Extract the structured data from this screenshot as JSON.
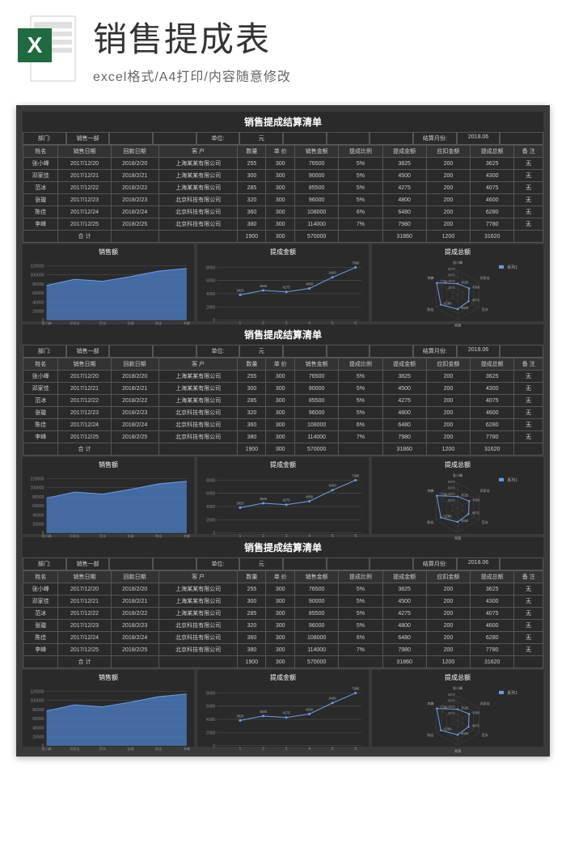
{
  "header": {
    "title": "销售提成表",
    "subtitle": "excel格式/A4打印/内容随意修改"
  },
  "section_title": "销售提成结算清单",
  "info_labels": {
    "dept": "部门:",
    "dept_val": "销售一部",
    "unit": "单位:",
    "unit_val": "元",
    "period": "结算月份:",
    "period_val": "2018.06"
  },
  "columns": [
    "姓名",
    "销售日期",
    "回款日期",
    "客 户",
    "数量",
    "单 价",
    "销售金额",
    "提成比例",
    "提成金额",
    "应扣金额",
    "提成总额",
    "备 注"
  ],
  "rows": [
    [
      "张小峰",
      "2017/12/20",
      "2018/2/20",
      "上海某某有限公司",
      "255",
      "300",
      "76500",
      "5%",
      "3825",
      "200",
      "3625",
      "无"
    ],
    [
      "邓家佳",
      "2017/12/21",
      "2018/2/21",
      "上海某某有限公司",
      "300",
      "300",
      "90000",
      "5%",
      "4500",
      "200",
      "4300",
      "无"
    ],
    [
      "范冰",
      "2017/12/22",
      "2018/2/22",
      "上海某某有限公司",
      "285",
      "300",
      "85500",
      "5%",
      "4275",
      "200",
      "4075",
      "无"
    ],
    [
      "张璇",
      "2017/12/23",
      "2018/2/23",
      "北京科技有限公司",
      "320",
      "300",
      "96000",
      "5%",
      "4800",
      "200",
      "4600",
      "无"
    ],
    [
      "陈佳",
      "2017/12/24",
      "2018/2/24",
      "北京科技有限公司",
      "360",
      "300",
      "108000",
      "6%",
      "6480",
      "200",
      "6280",
      "无"
    ],
    [
      "李峰",
      "2017/12/25",
      "2018/2/25",
      "北京科技有限公司",
      "380",
      "300",
      "114000",
      "7%",
      "7980",
      "200",
      "7780",
      "无"
    ]
  ],
  "total_row": [
    "",
    "合 计",
    "",
    "",
    "1900",
    "300",
    "570000",
    "",
    "31860",
    "1200",
    "31620",
    ""
  ],
  "chart_data": [
    {
      "type": "area",
      "title": "销售额",
      "categories": [
        "张小峰",
        "邓家佳",
        "范冰",
        "张璇",
        "陈佳",
        "李峰"
      ],
      "values": [
        76500,
        90000,
        85500,
        96000,
        108000,
        114000
      ],
      "ylim": [
        0,
        120000
      ],
      "yticks": [
        0,
        20000,
        40000,
        60000,
        80000,
        100000,
        120000
      ]
    },
    {
      "type": "line",
      "title": "提成金额",
      "x": [
        1,
        2,
        3,
        4,
        5,
        6
      ],
      "values": [
        3825,
        4500,
        4275,
        4800,
        6480,
        7980
      ],
      "labels": [
        "3825",
        "4500",
        "4275",
        "4800",
        "6480",
        "7980"
      ],
      "ylim": [
        0,
        8000
      ],
      "yticks": [
        0,
        2000,
        4000,
        6000,
        8000
      ]
    },
    {
      "type": "radar",
      "title": "提成总额",
      "categories": [
        "张小峰",
        "邓家佳",
        "范冰",
        "张璇",
        "陈佳",
        "李峰"
      ],
      "series_name": "系列1",
      "values": [
        3625,
        4300,
        4075,
        4600,
        6280,
        7780
      ],
      "rlim": [
        0,
        8000
      ],
      "rticks": [
        2000,
        4000,
        6000,
        8000
      ]
    }
  ]
}
